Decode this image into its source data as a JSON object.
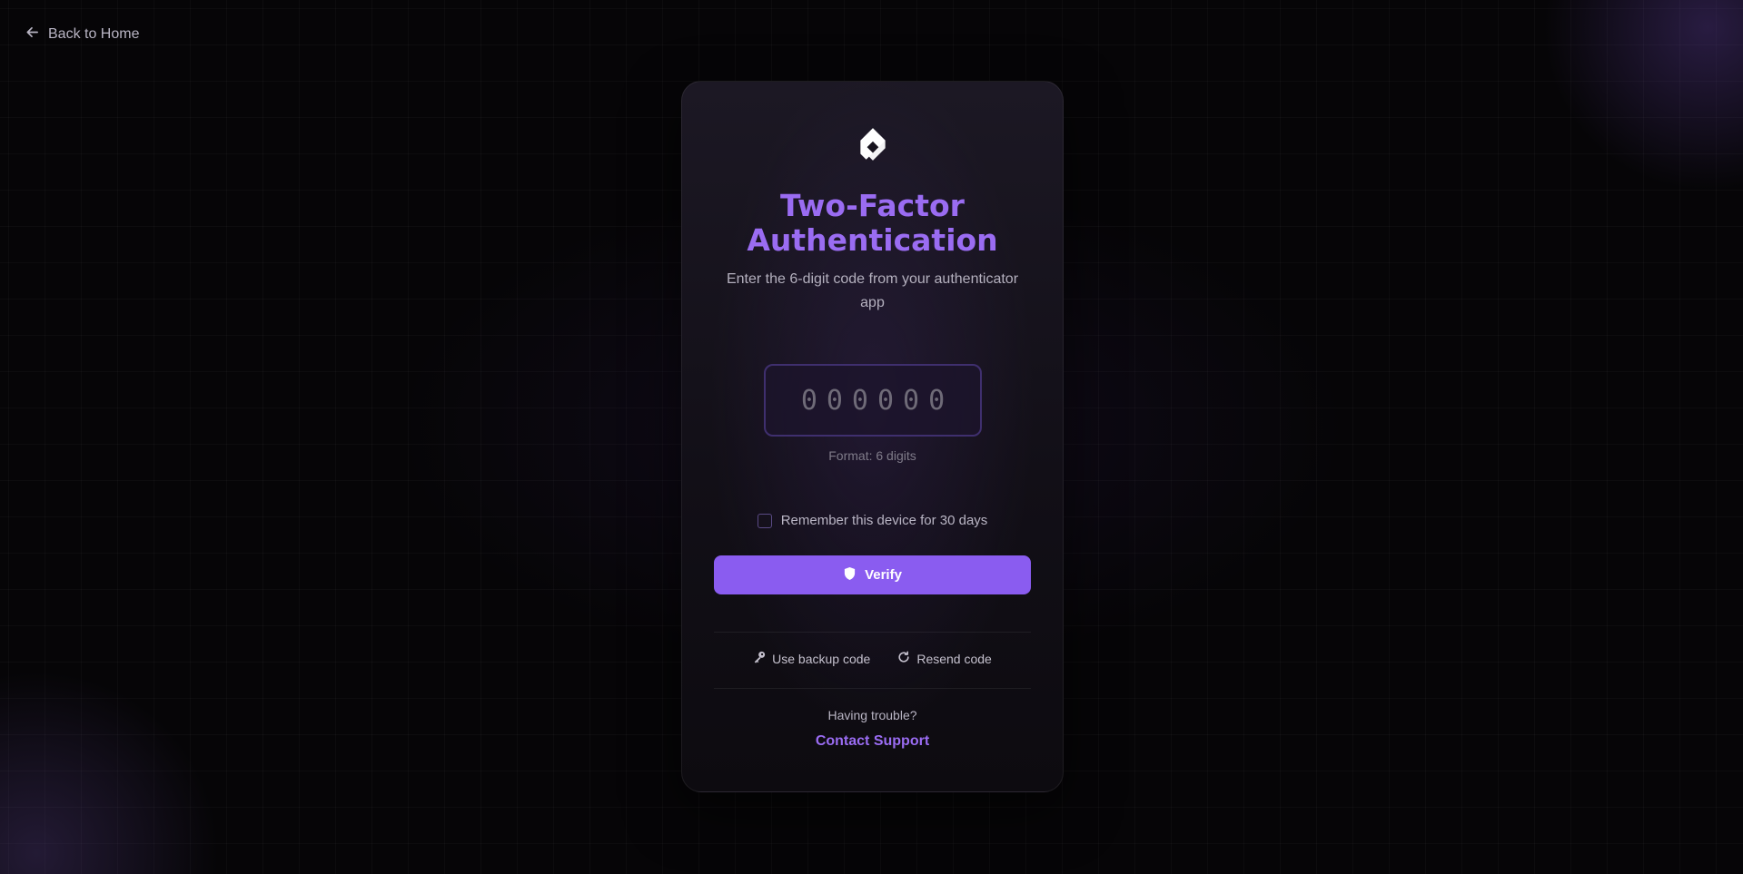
{
  "nav": {
    "back_label": "Back to Home",
    "back_icon": "arrow-left-icon"
  },
  "card": {
    "logo_icon": "brand-logo-icon",
    "title": "Two-Factor Authentication",
    "subtitle": "Enter the 6-digit code from your authenticator app",
    "code_input": {
      "value": "",
      "placeholder": "000000"
    },
    "format_hint": "Format: 6 digits",
    "remember_label": "Remember this device for 30 days",
    "remember_checked": false,
    "verify_label": "Verify",
    "verify_icon": "shield-icon",
    "backup_label": "Use backup code",
    "backup_icon": "key-icon",
    "resend_label": "Resend code",
    "resend_icon": "refresh-icon",
    "trouble_text": "Having trouble?",
    "support_label": "Contact Support"
  },
  "colors": {
    "accent": "#8a5cf0",
    "title": "#9a6cf2",
    "background": "#060507",
    "card": "#17131d"
  }
}
